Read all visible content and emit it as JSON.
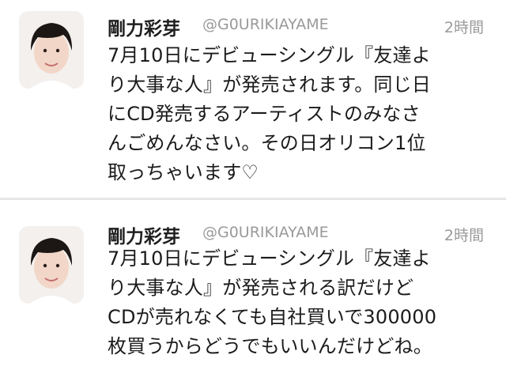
{
  "tweets": [
    {
      "name": "剛力彩芽",
      "handle": "@G0URIKIAYAME",
      "time": "2時間",
      "avatar_icon": "profile-photo",
      "lines": [
        "7月10日にデビューシングル『友達よ",
        "り大事な人』が発売されます。同じ日",
        "にCD発売するアーティストのみなさ",
        "んごめんなさい。その日オリコン1位",
        "取っちゃいます♡"
      ]
    },
    {
      "name": "剛力彩芽",
      "handle": "@G0URIKIAYAME",
      "time": "2時間",
      "avatar_icon": "profile-photo",
      "lines": [
        "7月10日にデビューシングル『友達よ",
        "り大事な人』が発売される訳だけど",
        "CDが売れなくても自社買いで300000",
        "枚買うからどうでもいいんだけどね。"
      ]
    }
  ],
  "colors": {
    "background": "#ffffff",
    "name": "#1f1f1f",
    "meta": "#9a9a9a",
    "divider": "#e6e6e6"
  }
}
